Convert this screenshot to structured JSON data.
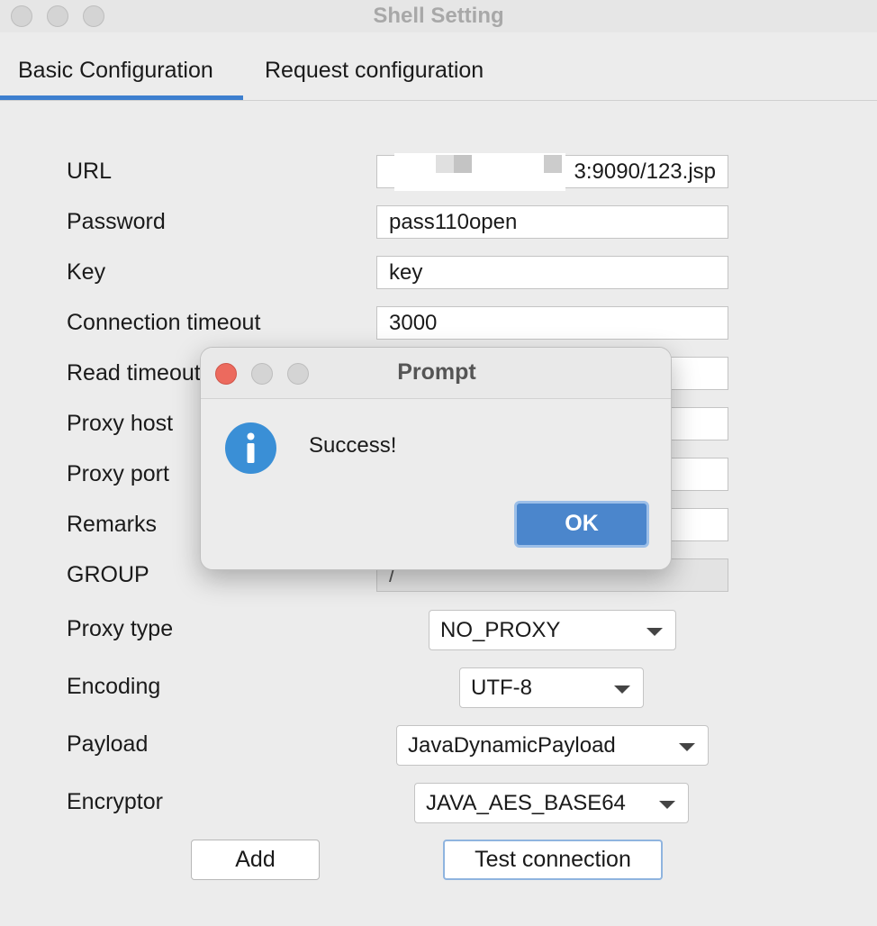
{
  "window": {
    "title": "Shell Setting"
  },
  "tabs": [
    {
      "label": "Basic Configuration",
      "active": true
    },
    {
      "label": "Request configuration",
      "active": false
    }
  ],
  "form": {
    "labels": {
      "url": "URL",
      "password": "Password",
      "key": "Key",
      "connection_timeout": "Connection timeout",
      "read_timeout": "Read timeout",
      "proxy_host": "Proxy host",
      "proxy_port": "Proxy port",
      "remarks": "Remarks",
      "group": "GROUP",
      "proxy_type": "Proxy type",
      "encoding": "Encoding",
      "payload": "Payload",
      "encryptor": "Encryptor"
    },
    "values": {
      "url_visible": "3:9090/123.jsp",
      "password": "pass110open",
      "key": "key",
      "connection_timeout": "3000",
      "group": "/",
      "proxy_type": "NO_PROXY",
      "encoding": "UTF-8",
      "payload": "JavaDynamicPayload",
      "encryptor": "JAVA_AES_BASE64"
    }
  },
  "buttons": {
    "add": "Add",
    "test_connection": "Test connection"
  },
  "dialog": {
    "title": "Prompt",
    "message": "Success!",
    "ok": "OK",
    "icon": "info-icon",
    "colors": {
      "close": "#ec6a5e",
      "accent": "#4b86cc",
      "info": "#3a8fd6"
    }
  }
}
